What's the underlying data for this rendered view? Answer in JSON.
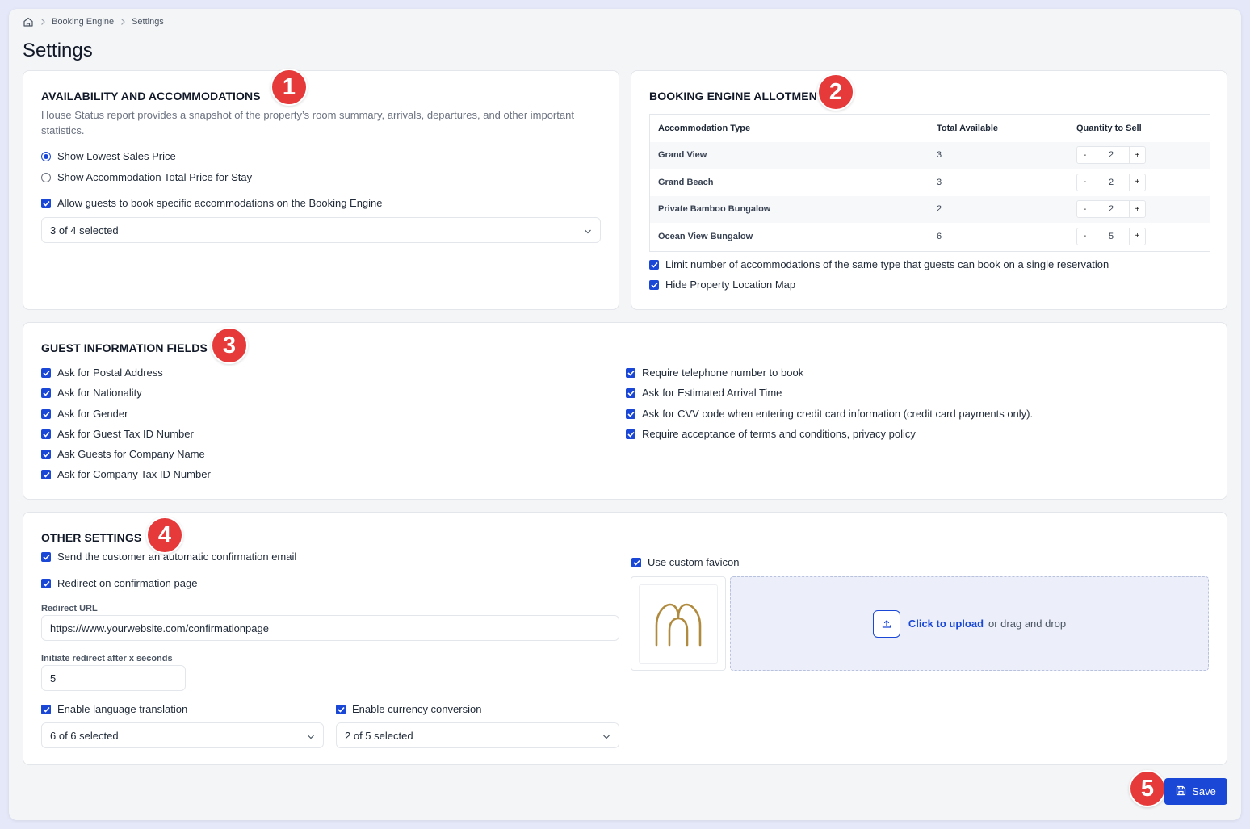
{
  "breadcrumb": {
    "home_icon": "home-icon",
    "items": [
      "Booking Engine",
      "Settings"
    ]
  },
  "page_title": "Settings",
  "colors": {
    "accent": "#1a47d6",
    "badge": "#e5393a",
    "favicon": "#b08a3e"
  },
  "availability": {
    "title": "AVAILABILITY AND ACCOMMODATIONS",
    "badge": "1",
    "description": "House Status report provides a snapshot of the property’s room summary, arrivals, departures, and other important statistics.",
    "radio_lowest": "Show Lowest Sales Price",
    "radio_total": "Show Accommodation Total Price for Stay",
    "selected_radio": "Show Lowest Sales Price",
    "allow_specific": "Allow guests to book specific accommodations on the Booking Engine",
    "accommodations_select": "3 of 4 selected"
  },
  "allotment": {
    "title": "BOOKING ENGINE ALLOTMENT",
    "badge": "2",
    "columns": [
      "Accommodation Type",
      "Total Available",
      "Quantity to Sell"
    ],
    "rows": [
      {
        "name": "Grand View",
        "available": "3",
        "qty": "2"
      },
      {
        "name": "Grand Beach",
        "available": "3",
        "qty": "2"
      },
      {
        "name": "Private Bamboo Bungalow",
        "available": "2",
        "qty": "2"
      },
      {
        "name": "Ocean View Bungalow",
        "available": "6",
        "qty": "5"
      }
    ],
    "minus": "-",
    "plus": "+",
    "limit_label": "Limit number of accommodations of the same type that guests can book on a single reservation",
    "hide_map_label": "Hide Property Location Map"
  },
  "guest_info": {
    "title": "GUEST INFORMATION FIELDS",
    "badge": "3",
    "left": [
      "Ask for Postal Address",
      "Ask for Nationality",
      "Ask for Gender",
      "Ask for Guest Tax ID Number",
      "Ask Guests for Company Name",
      "Ask for Company Tax ID Number"
    ],
    "right": [
      "Require telephone number to book",
      "Ask for Estimated Arrival Time",
      "Ask for CVV code when entering credit card information (credit card payments only).",
      "Require acceptance of terms and conditions, privacy policy"
    ]
  },
  "other": {
    "title": "OTHER SETTINGS",
    "badge": "4",
    "send_email": "Send the customer an automatic confirmation email",
    "redirect": "Redirect on confirmation page",
    "redirect_url_label": "Redirect URL",
    "redirect_url_value": "https://www.yourwebsite.com/confirmationpage",
    "redirect_after_label": "Initiate redirect after x seconds",
    "redirect_after_value": "5",
    "language_label": "Enable language translation",
    "language_select": "6 of 6 selected",
    "currency_label": "Enable currency conversion",
    "currency_select": "2 of 5 selected",
    "favicon_label": "Use custom favicon",
    "upload_link": "Click to upload",
    "upload_rest": "or drag and drop"
  },
  "save": {
    "label": "Save",
    "badge": "5"
  }
}
